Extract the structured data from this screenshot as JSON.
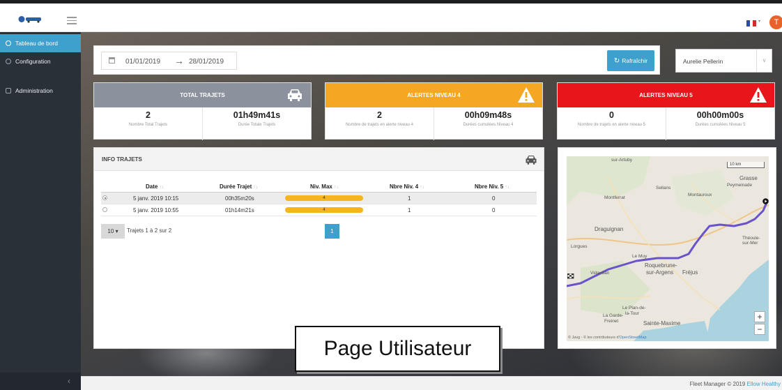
{
  "header": {
    "user_initial": "T",
    "language": "fr"
  },
  "sidebar": {
    "items": [
      {
        "label": "Tableau de bord",
        "active": true
      },
      {
        "label": "Configuration",
        "active": false
      },
      {
        "label": "Administration",
        "active": false
      }
    ],
    "collapse_icon": "chevron-left-icon"
  },
  "filters": {
    "date_from": "01/01/2019",
    "date_to": "28/01/2019",
    "refresh_label": "Rafraîchir",
    "selected_user": "Aurelie Pellerin"
  },
  "cards": [
    {
      "title": "TOTAL TRAJETS",
      "color": "#8b929e",
      "icon": "car-icon",
      "stats": [
        {
          "value": "2",
          "label": "Nombre Total Trajets"
        },
        {
          "value": "01h49m41s",
          "label": "Durée Totale Trajets"
        }
      ]
    },
    {
      "title": "ALERTES NIVEAU 4",
      "color": "#f5a623",
      "icon": "warning-icon",
      "stats": [
        {
          "value": "2",
          "label": "Nombre de trajets en alerte niveau 4"
        },
        {
          "value": "00h09m48s",
          "label": "Durées cumulées Niveau 4"
        }
      ]
    },
    {
      "title": "ALERTES NIVEAU 5",
      "color": "#e8161a",
      "icon": "warning-icon",
      "stats": [
        {
          "value": "0",
          "label": "Nombre de trajets en alerte niveau 5"
        },
        {
          "value": "00h00m00s",
          "label": "Durées cumulées Niveau 5"
        }
      ]
    }
  ],
  "info_trajets": {
    "title": "INFO TRAJETS",
    "columns": [
      "Date",
      "Durée Trajet",
      "Niv. Max",
      "Nbre Niv. 4",
      "Nbre Niv. 5"
    ],
    "rows": [
      {
        "date": "5 janv. 2019 10:15",
        "duree": "00h35m20s",
        "niv_max": "4",
        "niv4": "1",
        "niv5": "0",
        "selected": true
      },
      {
        "date": "5 janv. 2019 10:55",
        "duree": "01h14m21s",
        "niv_max": "4",
        "niv4": "1",
        "niv5": "0",
        "selected": false
      }
    ],
    "page_size": "10",
    "pager_info": "Trajets 1 à 2 sur 2",
    "current_page": "1"
  },
  "map": {
    "scale": "10 km",
    "zoom_in": "+",
    "zoom_out": "−",
    "attribution_prefix": "© Javg - © les contributeurs d'",
    "attribution_link": "OpenStreetMap",
    "places": {
      "p1": "sur-Artuby",
      "p2": "Grasse",
      "p3": "Peymeinade",
      "p4": "Sellans",
      "p5": "Montauroux",
      "p6": "Montferrat",
      "p7": "Draguignan",
      "p8": "Lorgues",
      "p9": "Théoule-sur-Mer",
      "p10": "Le Muy",
      "p11": "Roquebrune-",
      "p12": "sur-Argens",
      "p13": "Fréjus",
      "p14": "Vidauban",
      "p15": "Le Plan-de-",
      "p16": "la-Tour",
      "p17": "La Garde-",
      "p18": "Freinet",
      "p19": "Sainte-Maxime"
    }
  },
  "footer": {
    "text": "Fleet Manager © 2019 ",
    "link": "Ellow Healthy"
  },
  "caption": "Page Utilisateur"
}
